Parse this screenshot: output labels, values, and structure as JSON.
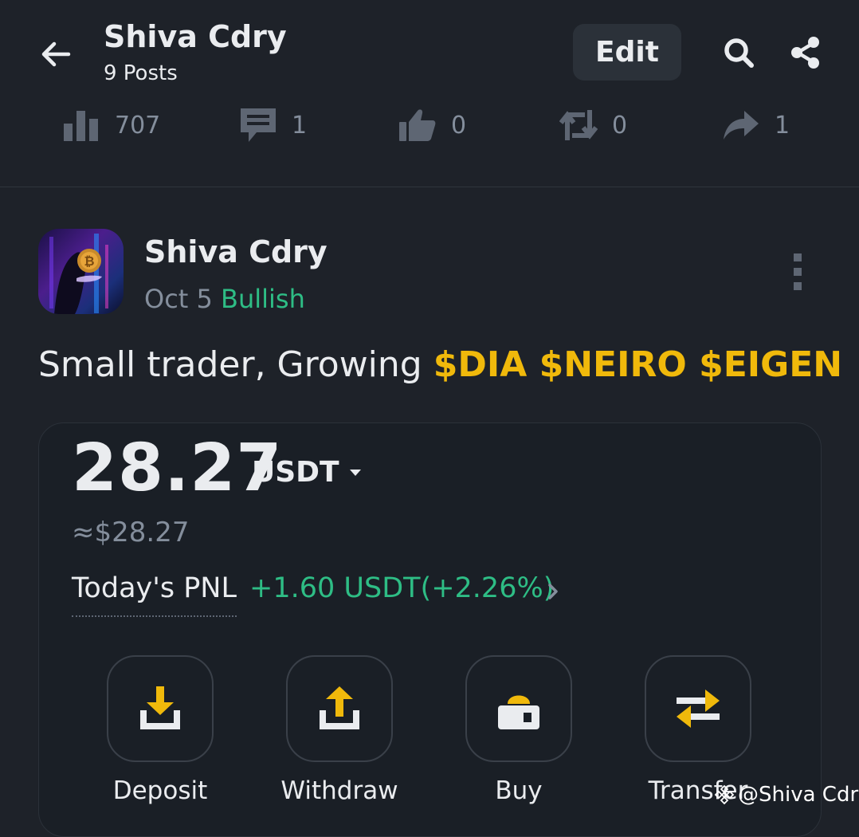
{
  "header": {
    "title": "Shiva Cdry",
    "posts_count": "9 Posts",
    "edit_label": "Edit",
    "icons": {
      "back": "back-arrow-icon",
      "search": "search-icon",
      "share": "share-icon"
    }
  },
  "stats": {
    "views": "707",
    "comments": "1",
    "likes": "0",
    "reposts": "0",
    "shares": "1"
  },
  "post": {
    "author": "Shiva Cdry",
    "date": "Oct 5",
    "sentiment": "Bullish",
    "text_plain": "Small trader, Growing ",
    "tags": [
      "$DIA",
      "$NEIRO",
      "$EIGEN"
    ]
  },
  "wallet_card": {
    "balance": "28.27",
    "currency": "USDT",
    "approx_fiat": "≈$28.27",
    "pnl_label": "Today's PNL",
    "pnl_value": "+1.60 USDT(+2.26%)",
    "actions": [
      "Deposit",
      "Withdraw",
      "Buy",
      "Transfer"
    ]
  },
  "watermark": "@Shiva Cdry",
  "colors": {
    "background": "#1e2229",
    "card": "#1a1f26",
    "accent": "#f0b90b",
    "positive": "#2ebd85",
    "muted": "#848e9c"
  }
}
